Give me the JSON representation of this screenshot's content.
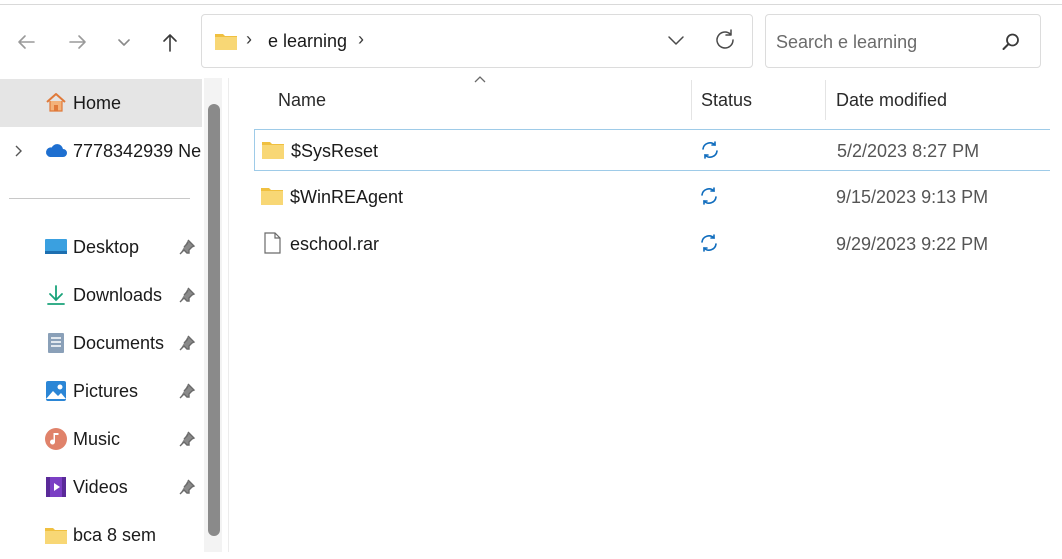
{
  "address": {
    "crumb": "e learning",
    "separator": "›"
  },
  "search": {
    "placeholder": "Search e learning"
  },
  "sidebar": {
    "home": {
      "label": "Home"
    },
    "onedrive": {
      "label": "7778342939 Ne"
    },
    "pinned": [
      {
        "label": "Desktop",
        "icon": "desktop-icon"
      },
      {
        "label": "Downloads",
        "icon": "downloads-icon"
      },
      {
        "label": "Documents",
        "icon": "documents-icon"
      },
      {
        "label": "Pictures",
        "icon": "pictures-icon"
      },
      {
        "label": "Music",
        "icon": "music-icon"
      },
      {
        "label": "Videos",
        "icon": "videos-icon"
      },
      {
        "label": "bca 8 sem",
        "icon": "folder-icon"
      }
    ]
  },
  "columns": {
    "name": "Name",
    "status": "Status",
    "date": "Date modified"
  },
  "files": [
    {
      "name": "$SysReset",
      "type": "folder",
      "date": "5/2/2023 8:27 PM"
    },
    {
      "name": "$WinREAgent",
      "type": "folder",
      "date": "9/15/2023 9:13 PM"
    },
    {
      "name": "eschool.rar",
      "type": "file",
      "date": "9/29/2023 9:22 PM"
    }
  ],
  "colors": {
    "accent": "#0f6cbd",
    "folder": "#f8d775",
    "selected_border": "#9ecbe8"
  }
}
